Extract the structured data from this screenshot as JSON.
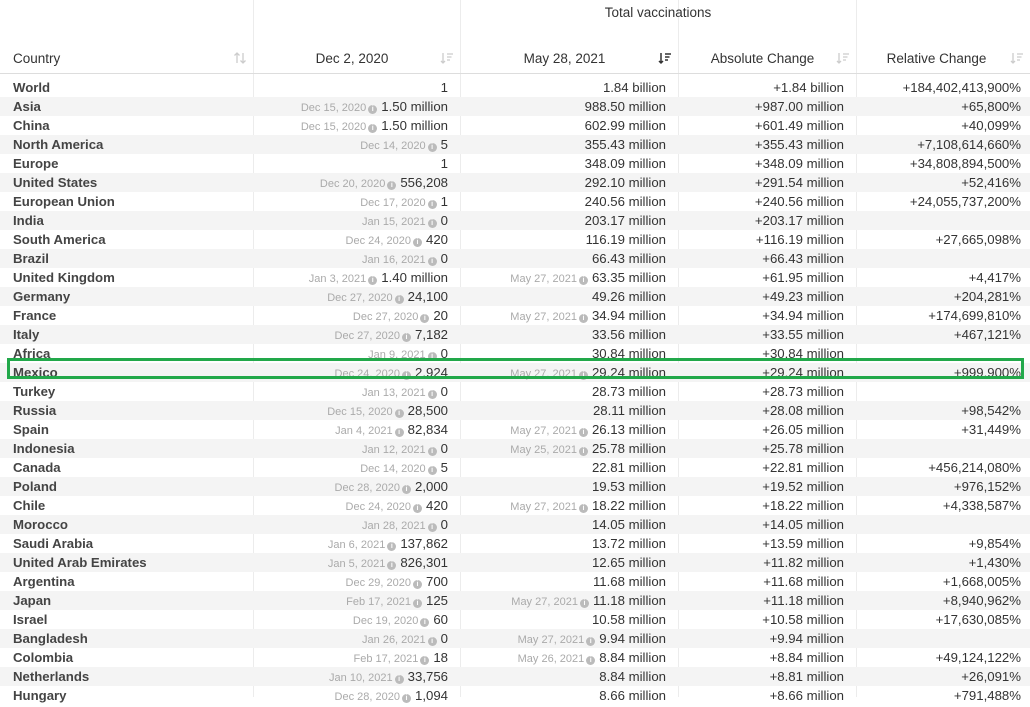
{
  "group_header": "Total vaccinations",
  "columns": [
    {
      "key": "country",
      "label": "Country"
    },
    {
      "key": "dec",
      "label": "Dec 2, 2020"
    },
    {
      "key": "may",
      "label": "May 28, 2021"
    },
    {
      "key": "abs",
      "label": "Absolute Change"
    },
    {
      "key": "rel",
      "label": "Relative Change"
    }
  ],
  "highlight_color": "#22a84a",
  "highlighted_row": "Mexico",
  "rows": [
    {
      "country": "World",
      "dec_note": "",
      "dec": "1",
      "may_note": "",
      "may": "1.84 billion",
      "abs": "+1.84 billion",
      "rel": "+184,402,413,900%"
    },
    {
      "country": "Asia",
      "dec_note": "Dec 15, 2020",
      "dec": "1.50 million",
      "may_note": "",
      "may": "988.50 million",
      "abs": "+987.00 million",
      "rel": "+65,800%"
    },
    {
      "country": "China",
      "dec_note": "Dec 15, 2020",
      "dec": "1.50 million",
      "may_note": "",
      "may": "602.99 million",
      "abs": "+601.49 million",
      "rel": "+40,099%"
    },
    {
      "country": "North America",
      "dec_note": "Dec 14, 2020",
      "dec": "5",
      "may_note": "",
      "may": "355.43 million",
      "abs": "+355.43 million",
      "rel": "+7,108,614,660%"
    },
    {
      "country": "Europe",
      "dec_note": "",
      "dec": "1",
      "may_note": "",
      "may": "348.09 million",
      "abs": "+348.09 million",
      "rel": "+34,808,894,500%"
    },
    {
      "country": "United States",
      "dec_note": "Dec 20, 2020",
      "dec": "556,208",
      "may_note": "",
      "may": "292.10 million",
      "abs": "+291.54 million",
      "rel": "+52,416%"
    },
    {
      "country": "European Union",
      "dec_note": "Dec 17, 2020",
      "dec": "1",
      "may_note": "",
      "may": "240.56 million",
      "abs": "+240.56 million",
      "rel": "+24,055,737,200%"
    },
    {
      "country": "India",
      "dec_note": "Jan 15, 2021",
      "dec": "0",
      "may_note": "",
      "may": "203.17 million",
      "abs": "+203.17 million",
      "rel": ""
    },
    {
      "country": "South America",
      "dec_note": "Dec 24, 2020",
      "dec": "420",
      "may_note": "",
      "may": "116.19 million",
      "abs": "+116.19 million",
      "rel": "+27,665,098%"
    },
    {
      "country": "Brazil",
      "dec_note": "Jan 16, 2021",
      "dec": "0",
      "may_note": "",
      "may": "66.43 million",
      "abs": "+66.43 million",
      "rel": ""
    },
    {
      "country": "United Kingdom",
      "dec_note": "Jan 3, 2021",
      "dec": "1.40 million",
      "may_note": "May 27, 2021",
      "may": "63.35 million",
      "abs": "+61.95 million",
      "rel": "+4,417%"
    },
    {
      "country": "Germany",
      "dec_note": "Dec 27, 2020",
      "dec": "24,100",
      "may_note": "",
      "may": "49.26 million",
      "abs": "+49.23 million",
      "rel": "+204,281%"
    },
    {
      "country": "France",
      "dec_note": "Dec 27, 2020",
      "dec": "20",
      "may_note": "May 27, 2021",
      "may": "34.94 million",
      "abs": "+34.94 million",
      "rel": "+174,699,810%"
    },
    {
      "country": "Italy",
      "dec_note": "Dec 27, 2020",
      "dec": "7,182",
      "may_note": "",
      "may": "33.56 million",
      "abs": "+33.55 million",
      "rel": "+467,121%"
    },
    {
      "country": "Africa",
      "dec_note": "Jan 9, 2021",
      "dec": "0",
      "may_note": "",
      "may": "30.84 million",
      "abs": "+30.84 million",
      "rel": ""
    },
    {
      "country": "Mexico",
      "dec_note": "Dec 24, 2020",
      "dec": "2,924",
      "may_note": "May 27, 2021",
      "may": "29.24 million",
      "abs": "+29.24 million",
      "rel": "+999,900%"
    },
    {
      "country": "Turkey",
      "dec_note": "Jan 13, 2021",
      "dec": "0",
      "may_note": "",
      "may": "28.73 million",
      "abs": "+28.73 million",
      "rel": ""
    },
    {
      "country": "Russia",
      "dec_note": "Dec 15, 2020",
      "dec": "28,500",
      "may_note": "",
      "may": "28.11 million",
      "abs": "+28.08 million",
      "rel": "+98,542%"
    },
    {
      "country": "Spain",
      "dec_note": "Jan 4, 2021",
      "dec": "82,834",
      "may_note": "May 27, 2021",
      "may": "26.13 million",
      "abs": "+26.05 million",
      "rel": "+31,449%"
    },
    {
      "country": "Indonesia",
      "dec_note": "Jan 12, 2021",
      "dec": "0",
      "may_note": "May 25, 2021",
      "may": "25.78 million",
      "abs": "+25.78 million",
      "rel": ""
    },
    {
      "country": "Canada",
      "dec_note": "Dec 14, 2020",
      "dec": "5",
      "may_note": "",
      "may": "22.81 million",
      "abs": "+22.81 million",
      "rel": "+456,214,080%"
    },
    {
      "country": "Poland",
      "dec_note": "Dec 28, 2020",
      "dec": "2,000",
      "may_note": "",
      "may": "19.53 million",
      "abs": "+19.52 million",
      "rel": "+976,152%"
    },
    {
      "country": "Chile",
      "dec_note": "Dec 24, 2020",
      "dec": "420",
      "may_note": "May 27, 2021",
      "may": "18.22 million",
      "abs": "+18.22 million",
      "rel": "+4,338,587%"
    },
    {
      "country": "Morocco",
      "dec_note": "Jan 28, 2021",
      "dec": "0",
      "may_note": "",
      "may": "14.05 million",
      "abs": "+14.05 million",
      "rel": ""
    },
    {
      "country": "Saudi Arabia",
      "dec_note": "Jan 6, 2021",
      "dec": "137,862",
      "may_note": "",
      "may": "13.72 million",
      "abs": "+13.59 million",
      "rel": "+9,854%"
    },
    {
      "country": "United Arab Emirates",
      "dec_note": "Jan 5, 2021",
      "dec": "826,301",
      "may_note": "",
      "may": "12.65 million",
      "abs": "+11.82 million",
      "rel": "+1,430%"
    },
    {
      "country": "Argentina",
      "dec_note": "Dec 29, 2020",
      "dec": "700",
      "may_note": "",
      "may": "11.68 million",
      "abs": "+11.68 million",
      "rel": "+1,668,005%"
    },
    {
      "country": "Japan",
      "dec_note": "Feb 17, 2021",
      "dec": "125",
      "may_note": "May 27, 2021",
      "may": "11.18 million",
      "abs": "+11.18 million",
      "rel": "+8,940,962%"
    },
    {
      "country": "Israel",
      "dec_note": "Dec 19, 2020",
      "dec": "60",
      "may_note": "",
      "may": "10.58 million",
      "abs": "+10.58 million",
      "rel": "+17,630,085%"
    },
    {
      "country": "Bangladesh",
      "dec_note": "Jan 26, 2021",
      "dec": "0",
      "may_note": "May 27, 2021",
      "may": "9.94 million",
      "abs": "+9.94 million",
      "rel": ""
    },
    {
      "country": "Colombia",
      "dec_note": "Feb 17, 2021",
      "dec": "18",
      "may_note": "May 26, 2021",
      "may": "8.84 million",
      "abs": "+8.84 million",
      "rel": "+49,124,122%"
    },
    {
      "country": "Netherlands",
      "dec_note": "Jan 10, 2021",
      "dec": "33,756",
      "may_note": "",
      "may": "8.84 million",
      "abs": "+8.81 million",
      "rel": "+26,091%"
    },
    {
      "country": "Hungary",
      "dec_note": "Dec 28, 2020",
      "dec": "1,094",
      "may_note": "",
      "may": "8.66 million",
      "abs": "+8.66 million",
      "rel": "+791,488%"
    }
  ]
}
